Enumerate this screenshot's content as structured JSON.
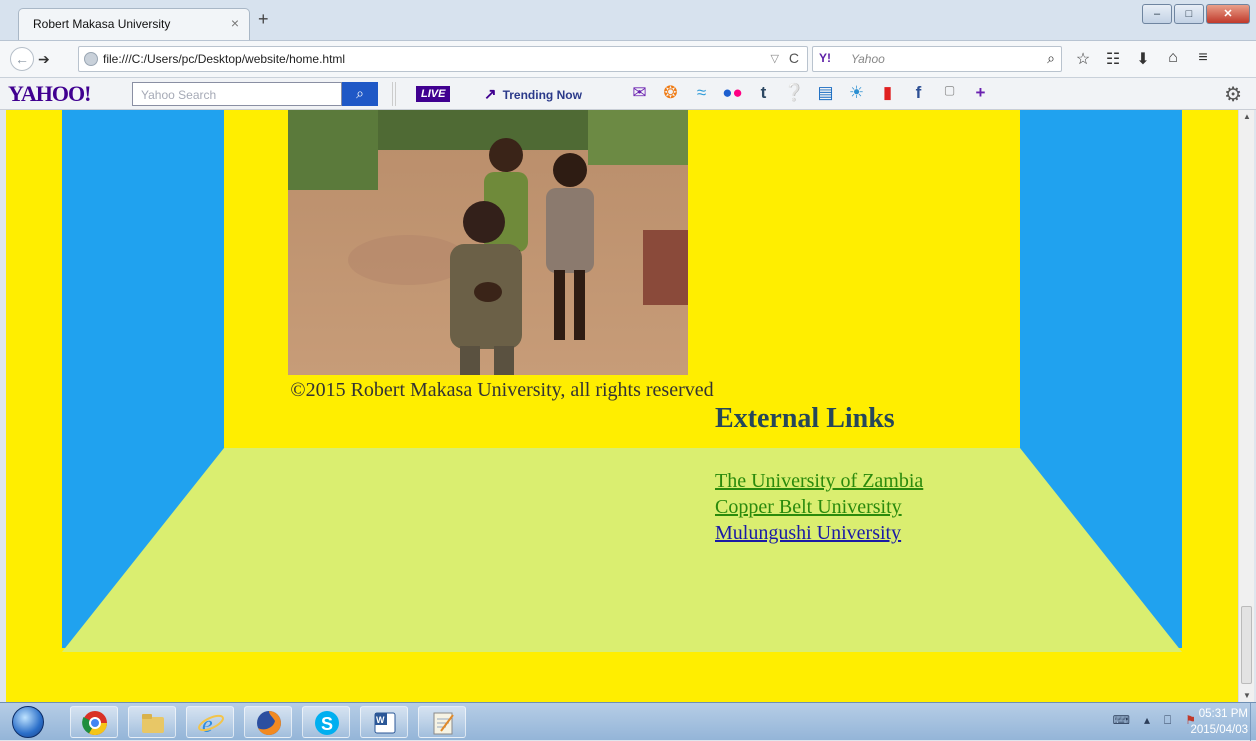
{
  "browser": {
    "tab_title": "Robert Makasa University",
    "tab_close": "×",
    "new_tab": "+",
    "url": "file:///C:/Users/pc/Desktop/website/home.html",
    "url_dropdown": "▽",
    "reload": "C",
    "search_engine_logo": "Y!",
    "search_placeholder": "Yahoo",
    "window_controls": {
      "minimize": "–",
      "maximize": "□",
      "close": "✕"
    }
  },
  "yahoo_toolbar": {
    "logo": "YAHOO!",
    "search_placeholder": "Yahoo Search",
    "live_label": "LIVE",
    "trending_label": "Trending Now"
  },
  "page": {
    "copyright": "©2015 Robert Makasa University, all rights reserved",
    "external_links_heading": "External Links",
    "links": [
      {
        "label": "The University of Zambia",
        "visited": true
      },
      {
        "label": "Copper Belt University",
        "visited": true
      },
      {
        "label": "Mulungushi University",
        "visited": false
      }
    ],
    "colors": {
      "background": "#ffee00",
      "pillars": "#20a2ef",
      "floor": "#daee70"
    }
  },
  "taskbar": {
    "time": "05:31 PM",
    "date": "2015/04/03"
  }
}
